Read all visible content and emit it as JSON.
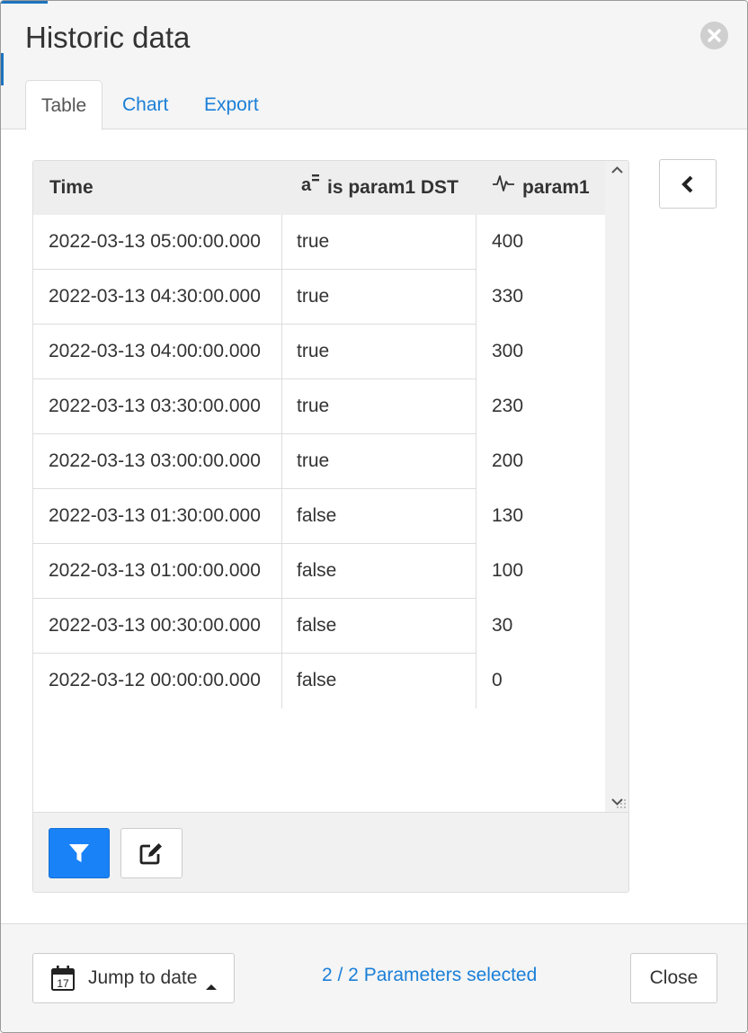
{
  "dialog": {
    "title": "Historic data",
    "tabs": [
      {
        "label": "Table",
        "active": true
      },
      {
        "label": "Chart",
        "active": false
      },
      {
        "label": "Export",
        "active": false
      }
    ]
  },
  "table": {
    "columns": [
      {
        "label": "Time",
        "icon": ""
      },
      {
        "label": "is param1 DST",
        "icon": "text-value-icon"
      },
      {
        "label": "param1",
        "icon": "signal-waveform-icon"
      }
    ],
    "rows": [
      {
        "time": "2022-03-13 05:00:00.000",
        "dst": "true",
        "value": "400"
      },
      {
        "time": "2022-03-13 04:30:00.000",
        "dst": "true",
        "value": "330"
      },
      {
        "time": "2022-03-13 04:00:00.000",
        "dst": "true",
        "value": "300"
      },
      {
        "time": "2022-03-13 03:30:00.000",
        "dst": "true",
        "value": "230"
      },
      {
        "time": "2022-03-13 03:00:00.000",
        "dst": "true",
        "value": "200"
      },
      {
        "time": "2022-03-13 01:30:00.000",
        "dst": "false",
        "value": "130"
      },
      {
        "time": "2022-03-13 01:00:00.000",
        "dst": "false",
        "value": "100"
      },
      {
        "time": "2022-03-13 00:30:00.000",
        "dst": "false",
        "value": "30"
      },
      {
        "time": "2022-03-12 00:00:00.000",
        "dst": "false",
        "value": "0"
      }
    ]
  },
  "footer": {
    "jump_label": "Jump to date",
    "calendar_day": "17",
    "params_label": "2 / 2 Parameters selected",
    "close_label": "Close"
  },
  "colors": {
    "accent": "#1a7fd8",
    "primary_button": "#1a82f7",
    "header_bg": "#f5f5f5",
    "grid_header_bg": "#eeeeee"
  }
}
